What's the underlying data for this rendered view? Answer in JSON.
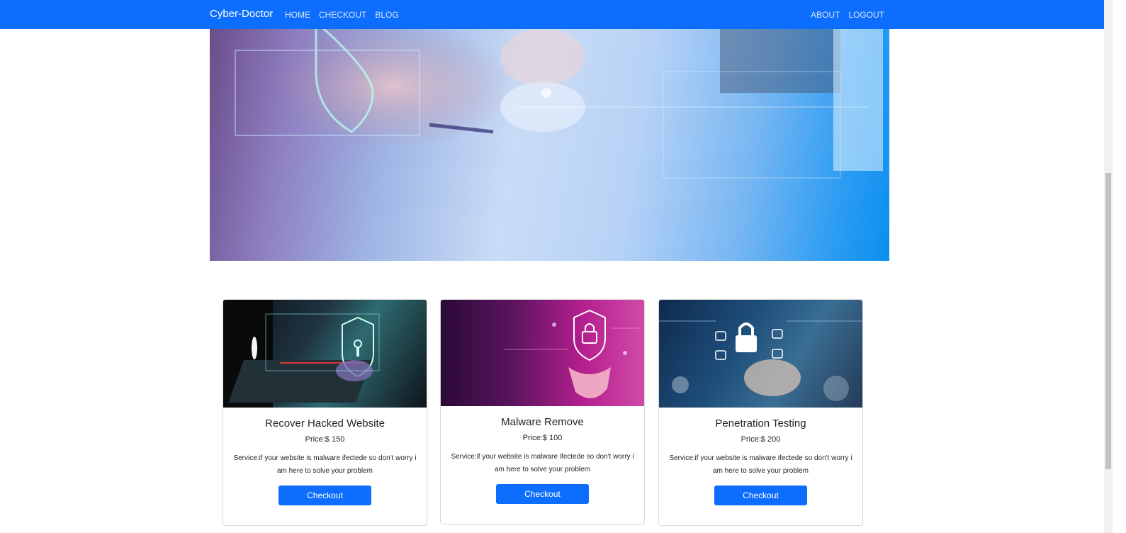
{
  "navbar": {
    "brand": "Cyber-Doctor",
    "left_links": [
      "HOME",
      "CHECKOUT",
      "BLOG"
    ],
    "right_links": [
      "ABOUT",
      "LOGOUT"
    ]
  },
  "colors": {
    "primary": "#0d6efd",
    "card_border": "#dfdfdf"
  },
  "services": [
    {
      "title": "Recover Hacked Website",
      "price": "Price:$ 150",
      "description": "Service:if your website is malware ifectede so don't worry i am here to solve your problem",
      "button": "Checkout",
      "image_icon": "shield-keyhole-laptop-icon"
    },
    {
      "title": "Malware Remove",
      "price": "Price:$ 100",
      "description": "Service:if your website is malware ifectede so don't worry i am here to solve your problem",
      "button": "Checkout",
      "image_icon": "padlock-hand-icon"
    },
    {
      "title": "Penetration Testing",
      "price": "Price:$ 200",
      "description": "Service:if your website is malware ifectede so don't worry i am here to solve your problem",
      "button": "Checkout",
      "image_icon": "padlock-network-icon"
    }
  ]
}
